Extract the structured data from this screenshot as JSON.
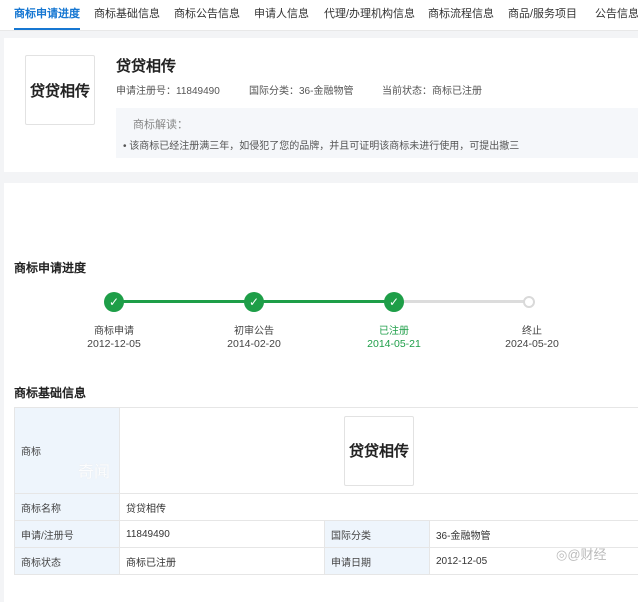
{
  "tabs": [
    {
      "label": "商标申请进度",
      "active": true
    },
    {
      "label": "商标基础信息"
    },
    {
      "label": "商标公告信息"
    },
    {
      "label": "申请人信息"
    },
    {
      "label": "代理/办理机构信息"
    },
    {
      "label": "商标流程信息"
    },
    {
      "label": "商品/服务项目"
    },
    {
      "label": "公告信息"
    }
  ],
  "summary": {
    "logo_text": "贷贷相传",
    "name": "贷贷相传",
    "reg_no": "申请注册号：11849490",
    "intl_class": "国际分类：36-金融物管",
    "status": "当前状态：商标已注册",
    "interp_title": "商标解读：",
    "interp_text": "• 该商标已经注册满三年，如侵犯了您的品牌，并且可证明该商标未进行使用，可提出撤三"
  },
  "progress": {
    "title": "商标申请进度",
    "steps": [
      {
        "label": "商标申请",
        "date": "2012-12-05",
        "done": true
      },
      {
        "label": "初审公告",
        "date": "2014-02-20",
        "done": true
      },
      {
        "label": "已注册",
        "date": "2014-05-21",
        "done": true,
        "current": true
      },
      {
        "label": "终止",
        "date": "2024-05-20",
        "done": false
      }
    ],
    "done_color": "#1e9e48"
  },
  "basic": {
    "title": "商标基础信息",
    "rows": {
      "trademark_label": "商标",
      "trademark_img_text": "贷贷相传",
      "name_label": "商标名称",
      "name_value": "贷贷相传",
      "reg_label": "申请/注册号",
      "reg_value": "11849490",
      "class_label": "国际分类",
      "class_value": "36-金融物管",
      "status_label": "商标状态",
      "status_value": "商标已注册",
      "date_label": "申请日期",
      "date_value": "2012-12-05"
    }
  },
  "watermarks": {
    "left": "奇闻",
    "right": "@财经"
  },
  "colors": {
    "accent": "#1677d2",
    "success": "#1e9e48"
  }
}
